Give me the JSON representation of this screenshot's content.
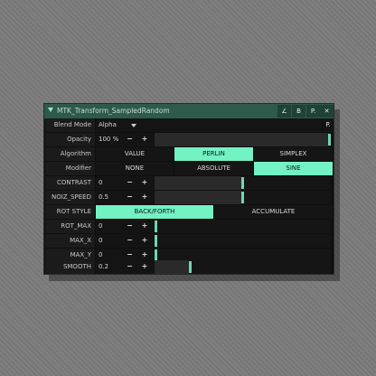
{
  "window": {
    "title": "MTK_Transform_SampledRandom",
    "buttons": {
      "b1": "∠",
      "b2": "B",
      "b3": "P.",
      "close": "✕"
    }
  },
  "blend_mode": {
    "label": "Blend Mode",
    "value": "Alpha",
    "picker": "P."
  },
  "opacity": {
    "label": "Opacity",
    "value": "100 %",
    "minus": "−",
    "plus": "+",
    "fraction": 1.0
  },
  "algorithm": {
    "label": "Algorithm",
    "options": [
      "VALUE",
      "PERLIN",
      "SIMPLEX"
    ],
    "selected": 1
  },
  "modifier": {
    "label": "Modifier",
    "options": [
      "NONE",
      "ABSOLUTE",
      "SINE"
    ],
    "selected": 2
  },
  "contrast": {
    "label": "CONTRAST",
    "value": "0",
    "minus": "−",
    "plus": "+",
    "fraction": 0.5
  },
  "noiz_speed": {
    "label": "NOIZ_SPEED",
    "value": "0.5",
    "minus": "−",
    "plus": "+",
    "fraction": 0.5
  },
  "rot_style": {
    "label": "ROT STYLE",
    "options": [
      "BACK/FORTH",
      "ACCUMULATE"
    ],
    "selected": 0
  },
  "rot_max": {
    "label": "ROT_MAX",
    "value": "0",
    "minus": "−",
    "plus": "+",
    "fraction": 0.0
  },
  "max_x": {
    "label": "MAX_X",
    "value": "0",
    "minus": "−",
    "plus": "+",
    "fraction": 0.0
  },
  "max_y": {
    "label": "MAX_Y",
    "value": "0",
    "minus": "−",
    "plus": "+",
    "fraction": 0.0
  },
  "smooth": {
    "label": "SMOOTH",
    "value": "0.2",
    "minus": "−",
    "plus": "+",
    "fraction": 0.2
  }
}
